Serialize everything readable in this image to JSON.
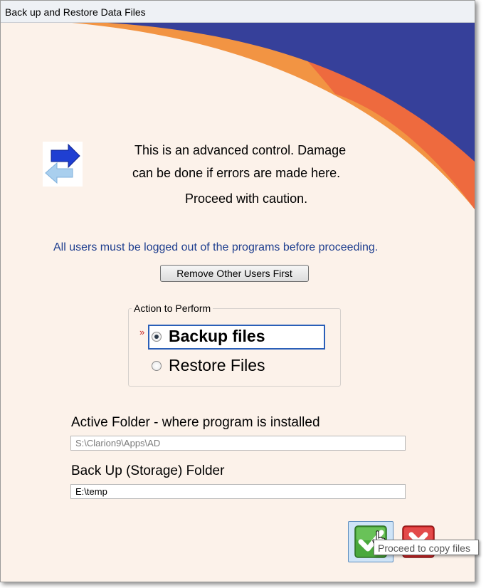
{
  "window": {
    "title": "Back up and Restore Data Files"
  },
  "caution": {
    "line1": "This is an advanced control.  Damage",
    "line2": "can be done if errors are made here.",
    "line3": "Proceed with caution."
  },
  "logout_note": "All users must be logged out of the programs before proceeding.",
  "remove_users_button": "Remove Other Users First",
  "action_group": {
    "legend": "Action to Perform",
    "required_mark": "»",
    "options": [
      {
        "label": "Backup files",
        "selected": true
      },
      {
        "label": "Restore Files",
        "selected": false
      }
    ]
  },
  "active_folder": {
    "label": "Active Folder - where program is installed",
    "value": "S:\\Clarion9\\Apps\\AD"
  },
  "backup_folder": {
    "label": "Back Up (Storage) Folder",
    "value": "E:\\temp"
  },
  "tooltip": "Proceed to copy files",
  "icons": {
    "ok": "checkmark-icon",
    "cancel": "x-icon",
    "direction": "double-arrow-icon"
  },
  "colors": {
    "navy": "#36409a",
    "orange": "#f29443",
    "red_orange": "#ee6a3e",
    "background": "#fcf2ea"
  }
}
